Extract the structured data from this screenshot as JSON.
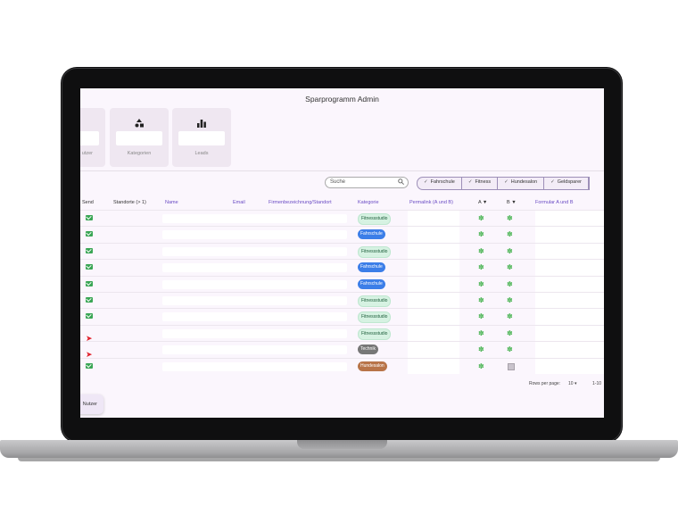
{
  "app": {
    "title": "Sparprogramm Admin"
  },
  "stats": [
    {
      "icon": "",
      "label": "utzer"
    },
    {
      "icon": "shapes-icon",
      "label": "Kategorien"
    },
    {
      "icon": "bar-chart-icon",
      "label": "Leads"
    }
  ],
  "search": {
    "placeholder": "Suche"
  },
  "filters": [
    "Fahrschule",
    "Fitness",
    "Hundesalon",
    "Geldsparer"
  ],
  "columns": {
    "send": "Send",
    "standorte": "Standorte (> 1)",
    "name": "Name",
    "email": "Email",
    "firma": "Firmenbezeichnung/Standort",
    "kategorie": "Kategorie",
    "permalink": "Permalink (A und B)",
    "a": "A",
    "b": "B",
    "formular": "Formular A und B"
  },
  "rows": [
    {
      "send": "mail",
      "kategorie": "Fitnessstudio",
      "type": "fitness",
      "b": "leaf"
    },
    {
      "send": "mail",
      "kategorie": "Fahrschule",
      "type": "fahrschule",
      "b": "leaf"
    },
    {
      "send": "mail",
      "kategorie": "Fitnessstudio",
      "type": "fitness",
      "b": "leaf"
    },
    {
      "send": "mail",
      "kategorie": "Fahrschule",
      "type": "fahrschule",
      "b": "leaf"
    },
    {
      "send": "mail",
      "kategorie": "Fahrschule",
      "type": "fahrschule",
      "b": "leaf"
    },
    {
      "send": "mail",
      "kategorie": "Fitnessstudio",
      "type": "fitness",
      "b": "leaf"
    },
    {
      "send": "mail",
      "kategorie": "Fitnessstudio",
      "type": "fitness",
      "b": "leaf"
    },
    {
      "send": "plane",
      "kategorie": "Fitnessstudio",
      "type": "fitness",
      "b": "leaf"
    },
    {
      "send": "plane",
      "kategorie": "Technik",
      "type": "technik",
      "b": "leaf"
    },
    {
      "send": "mail",
      "kategorie": "Hundesalon",
      "type": "hundesalon",
      "b": "box"
    }
  ],
  "pagination": {
    "label": "Rows per page:",
    "value": "10",
    "range": "1-10"
  },
  "fab": {
    "label": "Nutzer"
  }
}
